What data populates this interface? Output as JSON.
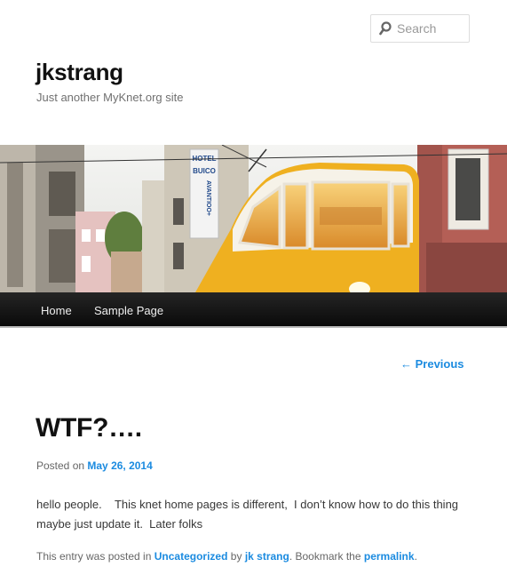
{
  "search": {
    "placeholder": "Search"
  },
  "site": {
    "title": "jkstrang",
    "description": "Just another MyKnet.org site"
  },
  "header_image": {
    "sign_lines": [
      "HOTEL",
      "BUICO",
      "AVANTIOO+"
    ]
  },
  "nav": {
    "items": [
      {
        "label": "Home"
      },
      {
        "label": "Sample Page"
      }
    ]
  },
  "post_nav": {
    "previous_label": "← Previous"
  },
  "post": {
    "title": "WTF?….",
    "posted_prefix": "Posted on",
    "date": "May 26, 2014",
    "content": "hello people.    This knet home pages is different,  I don’t know how to do this thing maybe just update it.  Later folks",
    "footer": {
      "prefix": "This entry was posted in",
      "category": "Uncategorized",
      "by": "by",
      "author": "jk strang",
      "bookmark": ". Bookmark the",
      "permalink": "permalink",
      "end": "."
    }
  },
  "colors": {
    "link": "#1b8be0",
    "tram_yellow": "#f0b020",
    "nav_bg": "#111111"
  }
}
